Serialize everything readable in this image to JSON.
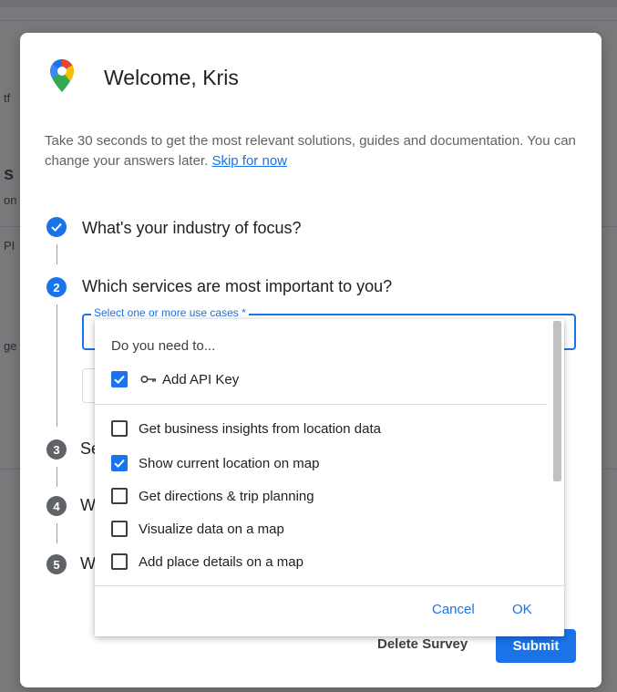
{
  "background": {
    "fragments": [
      "tf",
      "s",
      "on",
      "PI",
      "ge"
    ]
  },
  "dialog": {
    "title": "Welcome, Kris",
    "intro_text": "Take 30 seconds to get the most relevant solutions, guides and documentation. You can change your answers later.",
    "skip_link": "Skip for now",
    "steps": [
      {
        "number": "",
        "state": "done",
        "label": "What's your industry of focus?"
      },
      {
        "number": "2",
        "state": "active",
        "label": "Which services are most important to you?"
      },
      {
        "number": "3",
        "state": "pending",
        "label": "Se"
      },
      {
        "number": "4",
        "state": "pending",
        "label": "W"
      },
      {
        "number": "5",
        "state": "pending",
        "label": "W"
      }
    ],
    "select": {
      "label": "Select one or more use cases *"
    },
    "footer": {
      "delete_label": "Delete Survey",
      "submit_label": "Submit"
    }
  },
  "dropdown": {
    "header": "Do you need to...",
    "options": [
      {
        "label": "Add API Key",
        "checked": true,
        "icon": "key-icon"
      },
      {
        "label": "Get business insights from location data",
        "checked": false
      },
      {
        "label": "Show current location on map",
        "checked": true
      },
      {
        "label": "Get directions & trip planning",
        "checked": false
      },
      {
        "label": "Visualize data on a map",
        "checked": false
      },
      {
        "label": "Add place details on a map",
        "checked": false
      }
    ],
    "cancel_label": "Cancel",
    "ok_label": "OK"
  },
  "colors": {
    "accent": "#1a73e8",
    "text": "#202124",
    "muted": "#5f6368",
    "scrim": "rgba(32,33,36,0.6)"
  }
}
